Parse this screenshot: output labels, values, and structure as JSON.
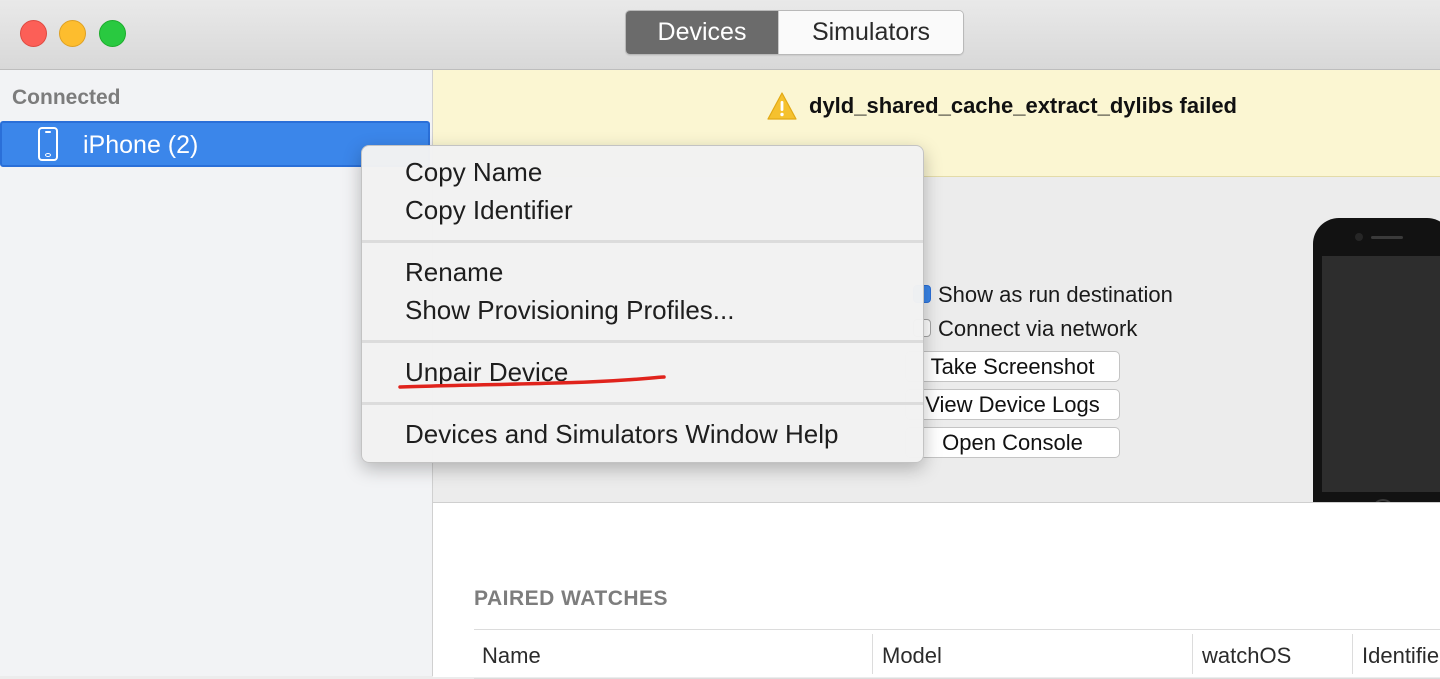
{
  "window": {
    "controls": [
      "close",
      "minimize",
      "zoom"
    ],
    "segments": [
      "Devices",
      "Simulators"
    ],
    "active_segment": "Devices"
  },
  "sidebar": {
    "section_title": "Connected",
    "selected_device": {
      "name": "iPhone (2)",
      "icon": "iphone-icon"
    }
  },
  "banner": {
    "icon": "warning-icon",
    "message": "dyld_shared_cache_extract_dylibs failed",
    "color": "#fbf6d2"
  },
  "device_panel": {
    "show_as_run_destination": {
      "label": "Show as run destination",
      "checked": true
    },
    "connect_via_network": {
      "label": "Connect via network",
      "checked": false
    },
    "buttons": {
      "take_screenshot": "Take Screenshot",
      "view_device_logs": "View Device Logs",
      "open_console": "Open Console"
    }
  },
  "paired_watches": {
    "title": "PAIRED WATCHES",
    "columns": [
      "Name",
      "Model",
      "watchOS",
      "Identifie"
    ]
  },
  "context_menu": {
    "groups": [
      [
        "Copy Name",
        "Copy Identifier"
      ],
      [
        "Rename",
        "Show Provisioning Profiles..."
      ],
      [
        "Unpair Device"
      ],
      [
        "Devices and Simulators Window Help"
      ]
    ],
    "annotated_item": "Unpair Device",
    "annotation_color": "#e0231c"
  },
  "colors": {
    "accent": "#3b86ea",
    "close": "#fc5f57",
    "minimize": "#fdbd2e",
    "zoom": "#29c940"
  }
}
